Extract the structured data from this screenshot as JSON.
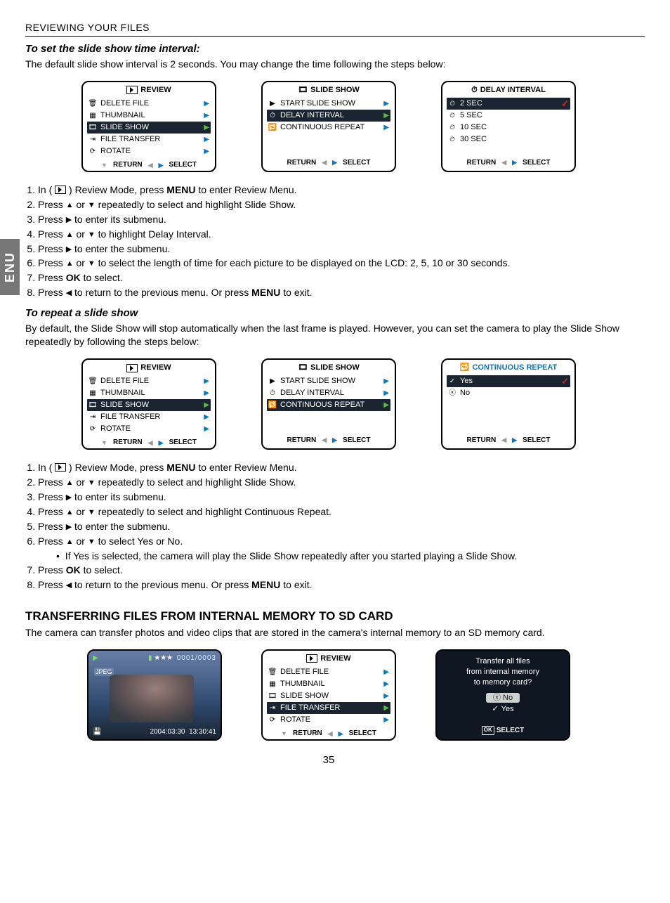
{
  "side_tab": "ENU",
  "header": "REVIEWING YOUR FILES",
  "page_number": "35",
  "sec1": {
    "title": "To set the slide show time interval:",
    "para": "The default slide show interval is 2 seconds. You may change the time following the steps below:"
  },
  "review_menu": {
    "title": "REVIEW",
    "items": [
      "DELETE FILE",
      "THUMBNAIL",
      "SLIDE SHOW",
      "FILE TRANSFER",
      "ROTATE"
    ],
    "return": "RETURN",
    "select": "SELECT"
  },
  "slide_menu": {
    "title": "SLIDE SHOW",
    "items": [
      "START SLIDE SHOW",
      "DELAY INTERVAL",
      "CONTINUOUS REPEAT"
    ],
    "return": "RETURN",
    "select": "SELECT"
  },
  "delay_menu": {
    "title": "DELAY INTERVAL",
    "items": [
      "2   SEC",
      "5   SEC",
      "10 SEC",
      "30 SEC"
    ],
    "return": "RETURN",
    "select": "SELECT"
  },
  "steps1": {
    "s1a": "In ( ",
    "s1b": " ) Review Mode, press ",
    "s1c": " to enter Review Menu.",
    "menu": "MENU",
    "s2": " repeatedly to select and highlight Slide Show.",
    "s3": " to enter its submenu.",
    "s4": " to highlight Delay Interval.",
    "s5": " to enter the submenu.",
    "s6": " to select the length of time for each picture to be displayed on the LCD: 2, 5, 10 or 30 seconds.",
    "s7a": "Press ",
    "s7b": " to select.",
    "ok": "OK",
    "s8": " to return to the previous menu. Or press ",
    "s8b": " to exit.",
    "press": "Press ",
    "or": " or "
  },
  "sec2": {
    "title": "To repeat a slide show",
    "para": "By default, the Slide Show will stop automatically when the last frame is played. However, you can set the camera to play the Slide Show repeatedly by following the steps below:"
  },
  "cont_menu": {
    "title": "CONTINUOUS REPEAT",
    "yes": "Yes",
    "no": "No",
    "return": "RETURN",
    "select": "SELECT"
  },
  "steps2": {
    "s4": " repeatedly to select and highlight Continuous Repeat.",
    "s6": " to select Yes or No.",
    "bullet": "If Yes is selected, the camera will play the Slide Show repeatedly after you started playing a Slide Show."
  },
  "sec3": {
    "title": "TRANSFERRING FILES FROM INTERNAL MEMORY TO SD CARD",
    "para": "The camera can transfer photos and video clips that are stored in the camera's internal memory to an SD memory card."
  },
  "photo": {
    "count": "0001/0003",
    "stars": "★★★",
    "jpeg": "JPEG",
    "date": "2004:03:30",
    "time": "13:30:41"
  },
  "transfer": {
    "l1": "Transfer all files",
    "l2": "from internal memory",
    "l3": "to memory card?",
    "no": "No",
    "yes": "Yes",
    "ok": "OK",
    "select": "SELECT"
  }
}
